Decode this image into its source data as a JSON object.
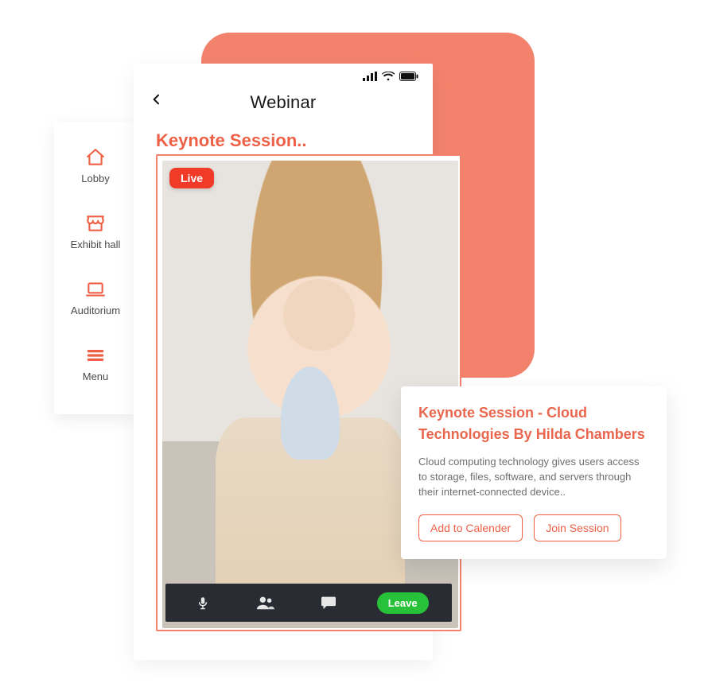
{
  "colors": {
    "accent": "#ee6147",
    "coral": "#f2826b",
    "live": "#ef3b27",
    "leave": "#27c23a"
  },
  "sidenav": {
    "items": [
      {
        "label": "Lobby",
        "icon": "home-icon"
      },
      {
        "label": "Exhibit hall",
        "icon": "store-icon"
      },
      {
        "label": "Auditorium",
        "icon": "laptop-icon"
      },
      {
        "label": "Menu",
        "icon": "menu-icon"
      }
    ]
  },
  "phone": {
    "title": "Webinar",
    "session_label": "Keynote Session.."
  },
  "video": {
    "live_badge": "Live"
  },
  "toolbar": {
    "leave_label": "Leave"
  },
  "details": {
    "title": "Keynote Session - Cloud Technologies  By Hilda Chambers",
    "description": "Cloud computing technology gives users access to storage, files, software, and servers through their internet-connected device..",
    "add_calendar_label": "Add to Calender",
    "join_label": "Join Session"
  }
}
